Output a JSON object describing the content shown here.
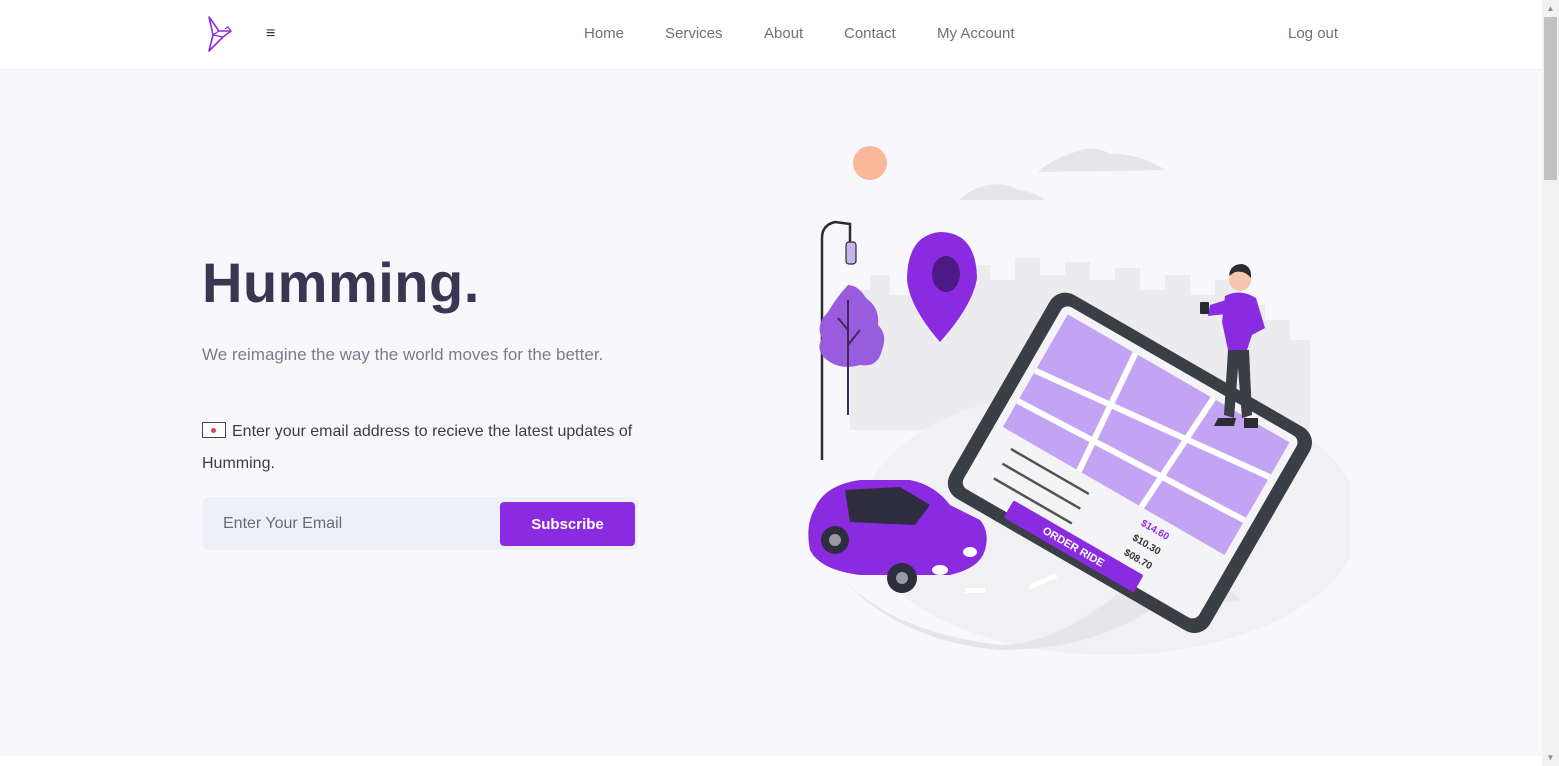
{
  "nav": {
    "menu_icon": "hamburger-icon",
    "logo_icon": "bird-logo-icon",
    "links": [
      "Home",
      "Services",
      "About",
      "Contact",
      "My Account"
    ],
    "logout": "Log out"
  },
  "hero": {
    "title": "Humming.",
    "subtitle": "We reimagine the way the world moves for the better.",
    "update_text": "Enter your email address to recieve the latest updates of Humming.",
    "update_icon": "envelope-icon"
  },
  "form": {
    "email_placeholder": "Enter Your Email",
    "email_value": "",
    "button_label": "Subscribe"
  },
  "illustration": {
    "phone_prices": [
      "$14.60",
      "$10.30",
      "$08.70"
    ],
    "order_button": "ORDER RIDE"
  },
  "colors": {
    "accent": "#8a2be2",
    "title": "#3a3550",
    "nav_text": "#6e6e7e",
    "background": "#f8f8fc"
  }
}
